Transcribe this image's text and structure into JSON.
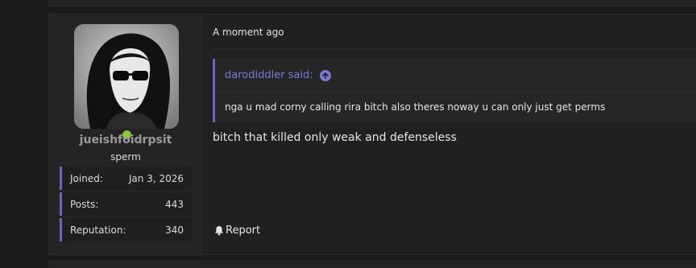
{
  "post": {
    "user": {
      "username": "jueishfoidrpsit",
      "title": "sperm",
      "online_color": "#8cc63e",
      "stats": [
        {
          "label": "Joined:",
          "value": "Jan 3, 2026"
        },
        {
          "label": "Posts:",
          "value": "443"
        },
        {
          "label": "Reputation:",
          "value": "340"
        }
      ]
    },
    "timestamp": "A moment ago",
    "quote": {
      "author": "darodiddler said:",
      "text": "nga u mad corny calling rira bitch also theres noway u can only just get perms"
    },
    "body": "bitch that killed only weak and defenseless",
    "actions": {
      "report_label": "Report"
    }
  },
  "colors": {
    "accent": "#6766c0",
    "quote_link": "#7b7bd6",
    "background": "#1b1b1b",
    "panel": "#202020"
  },
  "icons": {
    "quote_jump": "arrow-up-circle-icon",
    "report": "bell-icon",
    "online": "online-status-dot"
  }
}
